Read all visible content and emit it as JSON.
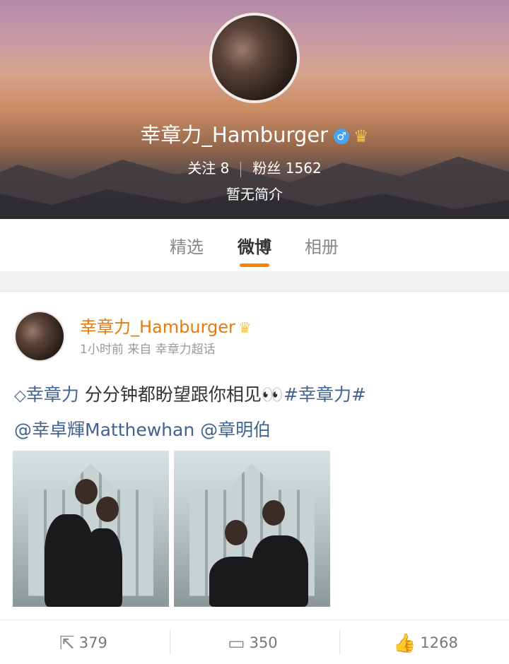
{
  "profile": {
    "name": "幸章力_Hamburger",
    "gender_symbol": "♂",
    "following_label": "关注",
    "following_count": "8",
    "followers_label": "粉丝",
    "followers_count": "1562",
    "bio": "暂无简介"
  },
  "tabs": [
    {
      "label": "精选",
      "active": false
    },
    {
      "label": "微博",
      "active": true
    },
    {
      "label": "相册",
      "active": false
    }
  ],
  "post": {
    "author": "幸章力_Hamburger",
    "time": "1小时前",
    "source_prefix": "来自",
    "source": "幸章力超话",
    "topic_link": "幸章力",
    "text": "分分钟都盼望跟你相见👀",
    "hashtag": "#幸章力#",
    "mention1": "@幸卓輝Matthewhan",
    "mention2": "@章明伯",
    "images": [
      "photo-1",
      "photo-2"
    ],
    "reposts": "379",
    "comments": "350",
    "likes": "1268"
  },
  "colors": {
    "accent": "#ff8200",
    "author_name": "#e8790b",
    "link": "#41638e",
    "verify_badge": "#4aa3f0"
  },
  "icons": [
    "gender-verify-icon",
    "crown-icon",
    "topic-diamond-icon",
    "repost-icon",
    "comment-icon",
    "like-icon"
  ]
}
